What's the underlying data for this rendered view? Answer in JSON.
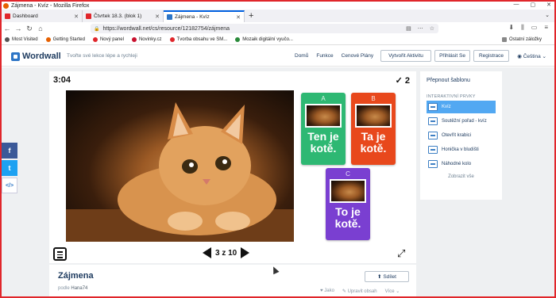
{
  "window": {
    "title": "Zájmena - Kvíz - Mozilla Firefox",
    "controls": [
      "—",
      "▢",
      "✕"
    ]
  },
  "tabs": [
    {
      "label": "Dashboard",
      "color": "#e0262b",
      "active": false
    },
    {
      "label": "Čtvrtek 18.3. (blok 1)",
      "color": "#e0262b",
      "active": false
    },
    {
      "label": "Zájmena - Kvíz",
      "color": "#2d75c6",
      "active": true
    }
  ],
  "browser": {
    "new_tab": "+",
    "tab_menu": "⌄",
    "back": "←",
    "forward": "→",
    "reload": "↻",
    "home": "⌂",
    "url": "https://wordwall.net/cs/resource/12182754/zájmena",
    "url_icons": [
      "▤",
      "⋯",
      "☆"
    ],
    "right_icons": [
      "⬇",
      "⫼",
      "▭",
      "≡"
    ]
  },
  "bookmarks": [
    {
      "label": "Most Visited",
      "color": "#555555"
    },
    {
      "label": "Getting Started",
      "color": "#e66000"
    },
    {
      "label": "Nový panel",
      "color": "#e0262b"
    },
    {
      "label": "Novinky.cz",
      "color": "#c8102e"
    },
    {
      "label": "Tvorba obsahu ve SM...",
      "color": "#e0262b"
    },
    {
      "label": "Mozaik digitální vyučo...",
      "color": "#2a8a3a"
    }
  ],
  "bookmarks_right": "Ostatní záložky",
  "header": {
    "logo": "Wordwall",
    "tagline": "Tvořte své lekce lépe a rychleji",
    "nav": [
      "Domů",
      "Funkce",
      "Cenové Plány"
    ],
    "create_button": "Vytvořit Aktivitu",
    "login_button": "Přihlásit Se",
    "register_button": "Registrace",
    "language": "Čeština"
  },
  "share": {
    "facebook": "f",
    "twitter": "t",
    "embed": "</>"
  },
  "game": {
    "timer": "3:04",
    "score": "2",
    "check": "✓",
    "answers": [
      {
        "letter": "A",
        "text": "Ten je kotě.",
        "color": "#2eb873"
      },
      {
        "letter": "B",
        "text": "Ta je kotě.",
        "color": "#e8481c"
      },
      {
        "letter": "C",
        "text": "To je kotě.",
        "color": "#7a3fd1"
      }
    ],
    "page_indicator": "3 z 10",
    "fullscreen": "⤢"
  },
  "panel": {
    "title": "Přepnout šablonu",
    "section": "INTERAKTIVNÍ PRVKY",
    "items": [
      {
        "label": "Kvíz",
        "active": true
      },
      {
        "label": "Soutěžní pořad - kvíz",
        "active": false
      },
      {
        "label": "Otevřít krabici",
        "active": false
      },
      {
        "label": "Honička v bludišti",
        "active": false
      },
      {
        "label": "Náhodné kolo",
        "active": false
      }
    ],
    "show_all": "Zobrazit vše"
  },
  "info": {
    "title": "Zájmena",
    "by_label": "podle",
    "author": "Hana74",
    "share_button": "Sdílet",
    "like": "♥ Jako",
    "edit": "✎ Upravit obsah",
    "more": "Více ⌄"
  }
}
